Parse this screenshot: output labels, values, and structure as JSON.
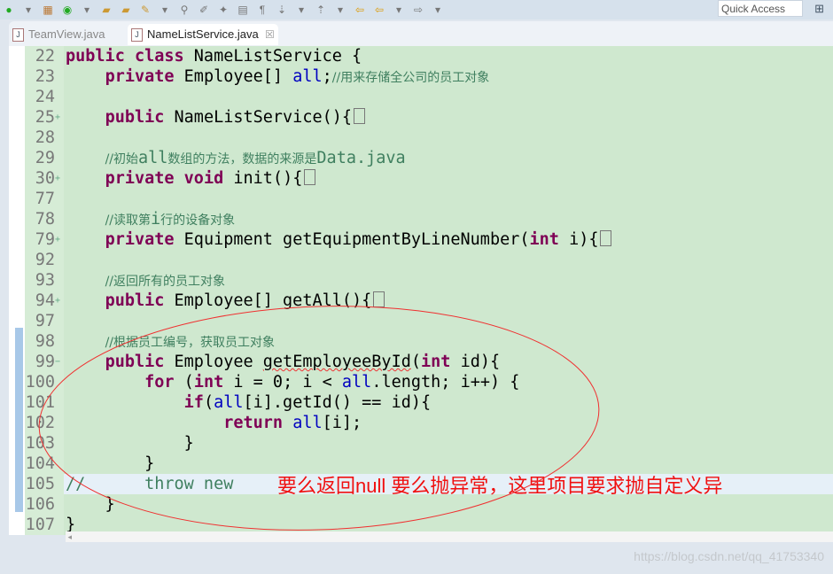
{
  "toolbar": {
    "quick_access": "Quick Access"
  },
  "tabs": [
    {
      "label": "TeamView.java"
    },
    {
      "label": "NameListService.java",
      "close": "☒"
    }
  ],
  "lines": [
    {
      "n": "22",
      "t": [
        [
          "kw",
          "public "
        ],
        [
          "kw",
          "class "
        ],
        [
          "",
          "NameListService {"
        ]
      ]
    },
    {
      "n": "23",
      "t": [
        [
          "",
          "    "
        ],
        [
          "kw",
          "private "
        ],
        [
          "",
          "Employee[] "
        ],
        [
          "fd",
          "all"
        ],
        [
          "",
          ";"
        ],
        [
          "cmz",
          "//用来存储全公司的员工对象"
        ]
      ]
    },
    {
      "n": "24",
      "t": []
    },
    {
      "n": "25",
      "fold": "+",
      "t": [
        [
          "",
          "    "
        ],
        [
          "kw",
          "public "
        ],
        [
          "",
          "NameListService(){"
        ],
        [
          "box",
          ""
        ]
      ]
    },
    {
      "n": "28",
      "t": []
    },
    {
      "n": "29",
      "t": [
        [
          "",
          "    "
        ],
        [
          "cmz",
          "//初始"
        ],
        [
          "cm",
          "all"
        ],
        [
          "cmz",
          "数组的方法，数据的来源是"
        ],
        [
          "cm",
          "Data.java"
        ]
      ]
    },
    {
      "n": "30",
      "fold": "+",
      "t": [
        [
          "",
          "    "
        ],
        [
          "kw",
          "private "
        ],
        [
          "kw",
          "void "
        ],
        [
          "",
          "init(){"
        ],
        [
          "box",
          ""
        ]
      ]
    },
    {
      "n": "77",
      "t": []
    },
    {
      "n": "78",
      "t": [
        [
          "",
          "    "
        ],
        [
          "cmz",
          "//读取第"
        ],
        [
          "cm",
          "i"
        ],
        [
          "cmz",
          "行的设备对象"
        ]
      ]
    },
    {
      "n": "79",
      "fold": "+",
      "t": [
        [
          "",
          "    "
        ],
        [
          "kw",
          "private "
        ],
        [
          "",
          "Equipment getEquipmentByLineNumber("
        ],
        [
          "kw",
          "int "
        ],
        [
          "",
          "i){"
        ],
        [
          "box",
          ""
        ]
      ]
    },
    {
      "n": "92",
      "t": []
    },
    {
      "n": "93",
      "t": [
        [
          "",
          "    "
        ],
        [
          "cmz",
          "//返回所有的员工对象"
        ]
      ]
    },
    {
      "n": "94",
      "fold": "+",
      "t": [
        [
          "",
          "    "
        ],
        [
          "kw",
          "public "
        ],
        [
          "",
          "Employee[] getAll(){"
        ],
        [
          "box",
          ""
        ]
      ]
    },
    {
      "n": "97",
      "t": []
    },
    {
      "n": "98",
      "t": [
        [
          "",
          "    "
        ],
        [
          "cmz",
          "//根据员工编号，获取员工对象"
        ]
      ]
    },
    {
      "n": "99",
      "fold": "−",
      "t": [
        [
          "",
          "    "
        ],
        [
          "kw",
          "public "
        ],
        [
          "",
          "Employee "
        ],
        [
          "err",
          "getEmployeeById"
        ],
        [
          "",
          "("
        ],
        [
          "kw",
          "int "
        ],
        [
          "",
          "id){"
        ]
      ]
    },
    {
      "n": "100",
      "t": [
        [
          "",
          "        "
        ],
        [
          "kw",
          "for "
        ],
        [
          "",
          "("
        ],
        [
          "kw",
          "int "
        ],
        [
          "",
          "i = 0; i < "
        ],
        [
          "fd",
          "all"
        ],
        [
          "",
          ".length; i++) {"
        ]
      ]
    },
    {
      "n": "101",
      "t": [
        [
          "",
          "            "
        ],
        [
          "kw",
          "if"
        ],
        [
          "",
          "("
        ],
        [
          "fd",
          "all"
        ],
        [
          "",
          "[i].getId() == id){"
        ]
      ]
    },
    {
      "n": "102",
      "t": [
        [
          "",
          "                "
        ],
        [
          "kw",
          "return "
        ],
        [
          "fd",
          "all"
        ],
        [
          "",
          "[i];"
        ]
      ]
    },
    {
      "n": "103",
      "t": [
        [
          "",
          "            }"
        ]
      ]
    },
    {
      "n": "104",
      "t": [
        [
          "",
          "        }"
        ]
      ]
    },
    {
      "n": "105",
      "hl": true,
      "t": [
        [
          "cm",
          "//      throw new"
        ]
      ]
    },
    {
      "n": "106",
      "t": [
        [
          "",
          "    }"
        ]
      ]
    },
    {
      "n": "107",
      "t": [
        [
          "",
          "}"
        ]
      ]
    }
  ],
  "annotation": "要么返回null 要么抛异常，这里项目要求抛自定义异",
  "watermark": "https://blog.csdn.net/qq_41753340",
  "colors": {
    "editor_bg": "#cfe8cf",
    "keyword": "#7f0055",
    "field": "#0000c0",
    "comment": "#3f7f5f",
    "annotation": "#f01010"
  }
}
